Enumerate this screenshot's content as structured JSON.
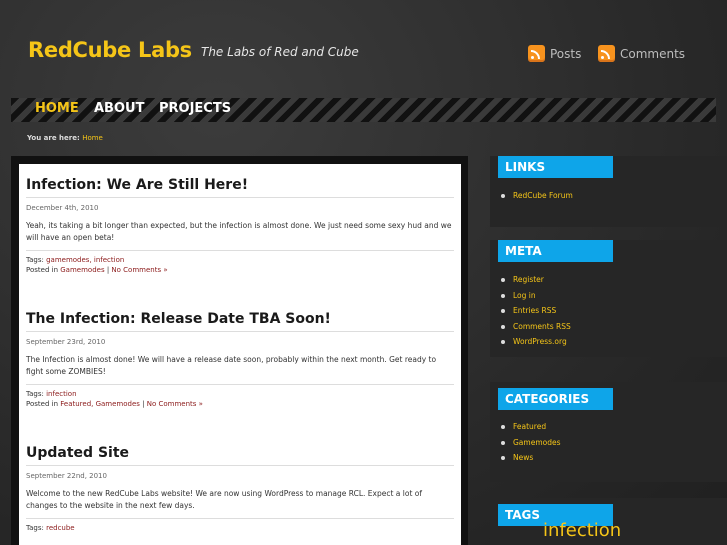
{
  "header": {
    "site_title": "RedCube Labs",
    "tagline": "The Labs of Red and Cube",
    "feeds": [
      {
        "label": "Posts",
        "icon": "rss-icon"
      },
      {
        "label": "Comments",
        "icon": "rss-icon"
      }
    ]
  },
  "nav": {
    "items": [
      {
        "label": "HOME"
      },
      {
        "label": "ABOUT"
      },
      {
        "label": "PROJECTS"
      }
    ],
    "active_color": "#f5c518"
  },
  "breadcrumb": {
    "prefix": "You are here:",
    "current": "Home"
  },
  "posts": [
    {
      "title": "Infection: We Are Still Here!",
      "date": "December 4th, 2010",
      "body": "Yeah, its taking a bit longer than expected, but the infection is almost done. We just need some sexy hud and we will have an open beta!",
      "tags_label": "Tags:",
      "tags": "gamemodes, infection",
      "posted_label": "Posted in",
      "categories": "Gamemodes",
      "comments": "No Comments »"
    },
    {
      "title": "The Infection: Release Date TBA Soon!",
      "date": "September 23rd, 2010",
      "body": "The Infection is almost done! We will have a release date soon, probably within the next month. Get ready to fight some ZOMBIES!",
      "tags_label": "Tags:",
      "tags": "infection",
      "posted_label": "Posted in",
      "categories": "Featured, Gamemodes",
      "comments": "No Comments »"
    },
    {
      "title": "Updated Site",
      "date": "September 22nd, 2010",
      "body": "Welcome to the new RedCube Labs website! We are now using WordPress to manage RCL. Expect a lot of changes to the website in the next few days.",
      "tags_label": "Tags:",
      "tags": "redcube"
    }
  ],
  "sidebar": {
    "links": {
      "title": "LINKS",
      "items": [
        "RedCube Forum"
      ]
    },
    "meta": {
      "title": "META",
      "items": [
        "Register",
        "Log in",
        "Entries RSS",
        "Comments RSS",
        "WordPress.org"
      ]
    },
    "categories": {
      "title": "CATEGORIES",
      "items": [
        "Featured",
        "Gamemodes",
        "News"
      ]
    },
    "tags": {
      "title": "TAGS",
      "cloud_first": "infection"
    }
  },
  "colors": {
    "accent": "#f5c518",
    "widget_title_bg": "#0ea5e9",
    "link_red": "#8b1a1a"
  }
}
